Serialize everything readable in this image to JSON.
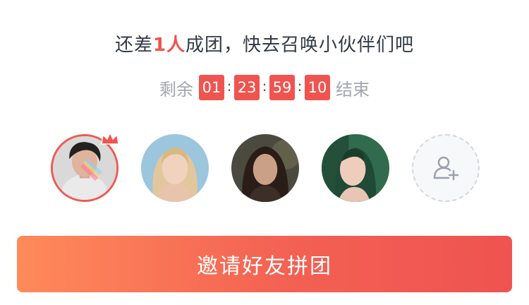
{
  "title": {
    "prefix": "还差",
    "count": "1人",
    "suffix": "成团，快去召唤小伙伴们吧"
  },
  "countdown": {
    "label_before": "剩余",
    "hours": "01",
    "minutes": "23",
    "seconds": "59",
    "fraction": "10",
    "separator": ":",
    "label_after": "结束"
  },
  "members": [
    {
      "role": "owner",
      "icon": "crown-icon"
    },
    {
      "role": "member"
    },
    {
      "role": "member"
    },
    {
      "role": "member"
    }
  ],
  "invite_slot": {
    "icon": "add-user-icon"
  },
  "cta": {
    "label": "邀请好友拼团"
  },
  "colors": {
    "accent": "#f0534f",
    "timer_bg": "#f0544f",
    "cta_gradient_start": "#ff8a5a",
    "cta_gradient_end": "#ef5350"
  }
}
